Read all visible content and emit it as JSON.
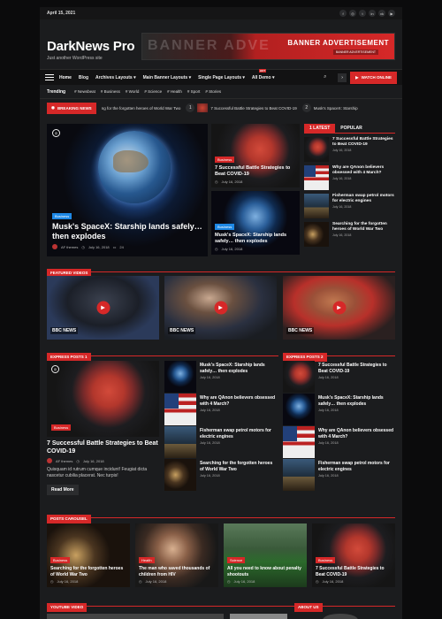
{
  "topbar": {
    "date": "April 15, 2021",
    "social": [
      "f",
      "◎",
      "t",
      "in",
      "vk",
      "▶"
    ]
  },
  "header": {
    "site_title": "DarkNews Pro",
    "tagline": "Just another WordPress site",
    "banner_ghost": "BANNER ADVE",
    "banner_title": "BANNER ADVERTISEMENT",
    "banner_sub": "BANNER ADVERTISEMENT"
  },
  "nav": {
    "items": [
      "Home",
      "Blog",
      "Archives Layouts ▾",
      "Main Banner Layouts ▾",
      "Single Page Layouts ▾",
      "All Demo ▾"
    ],
    "hot_badge": "HOT",
    "watch_label": "WATCH ONLINE"
  },
  "tags": {
    "label": "Trending",
    "items": [
      "# Newsbeat",
      "# Business",
      "# World",
      "# Science",
      "# Health",
      "# Sport",
      "# Stories"
    ]
  },
  "ticker": {
    "breaking_label": "BREAKING NEWS",
    "item1": "ng for the forgotten heroes of World War Two",
    "item2_num": "1",
    "item2": "7 Successful Battle Strategies to Beat COVID-19",
    "item3_num": "2",
    "item3": "Musk's SpaceX: Starship"
  },
  "hero": {
    "category": "Business",
    "title": "Musk's SpaceX: Starship lands safely… then explodes",
    "author": "AF themes",
    "date": "July 16, 2018",
    "comments": "24"
  },
  "mid_cards": [
    {
      "category": "Business",
      "title": "7 Successful Battle Strategies to Beat COVID-19",
      "date": "July 16, 2018"
    },
    {
      "category": "Business",
      "title": "Musk's SpaceX: Starship lands safely… then explodes",
      "date": "July 16, 2018"
    }
  ],
  "sidebar": {
    "tab_latest": "LATEST",
    "tab_popular": "POPULAR",
    "tab_num": "1",
    "items": [
      {
        "title": "7 Successful Battle Strategies to Beat COVID-19",
        "date": "July 16, 2018"
      },
      {
        "title": "Why are QAnon believers obsessed with 4 March?",
        "date": "July 16, 2018"
      },
      {
        "title": "Fisherman swap petrol motors for electric engines",
        "date": "July 16, 2018"
      },
      {
        "title": "Searching for the forgotten heroes of World War Two",
        "date": "July 16, 2018"
      }
    ]
  },
  "sections": {
    "featured_videos": "FEATURED VIDEOS",
    "express_posts_1": "EXPRESS POSTS 1",
    "express_posts_2": "EXPRESS POSTS 2",
    "posts_carousel": "POSTS CAROUSEL",
    "youtube_video": "YOUTUBE VIDEO",
    "about_us": "ABOUT US"
  },
  "videos": {
    "network": "BBC NEWS"
  },
  "express1": {
    "main": {
      "category": "Business",
      "title": "7 Successful Battle Strategies to Beat COVID-19",
      "author": "AF themes",
      "date": "July 16, 2018",
      "excerpt": "Quisquam id rutrum cumque incidunt! Feugiat dicta nascetur cubilia placerat. Nec turpis!",
      "readmore": "Read More"
    },
    "list": [
      {
        "title": "Musk's SpaceX: Starship lands safely… then explodes",
        "date": "July 16, 2018"
      },
      {
        "title": "Why are QAnon believers obsessed with 4 March?",
        "date": "July 16, 2018"
      },
      {
        "title": "Fisherman swap petrol motors for electric engines",
        "date": "July 16, 2018"
      },
      {
        "title": "Searching for the forgotten heroes of World War Two",
        "date": "July 16, 2018"
      }
    ]
  },
  "express2": {
    "list": [
      {
        "title": "7 Successful Battle Strategies to Beat COVID-19",
        "date": "July 16, 2018"
      },
      {
        "title": "Musk's SpaceX: Starship lands safely… then explodes",
        "date": "July 16, 2018"
      },
      {
        "title": "Why are QAnon believers obsessed with 4 March?",
        "date": "July 16, 2018"
      },
      {
        "title": "Fisherman swap petrol motors for electric engines",
        "date": "July 16, 2018"
      }
    ]
  },
  "carousel": [
    {
      "category": "Business",
      "title": "Searching for the forgotten heroes of World War Two",
      "date": "July 16, 2018"
    },
    {
      "category": "Health",
      "title": "The man who saved thousands of children from HIV",
      "date": "July 16, 2018"
    },
    {
      "category": "Science",
      "title": "All you need to know about penalty shootouts",
      "date": "July 16, 2018"
    },
    {
      "category": "Business",
      "title": "7 Successful Battle Strategies to Beat COVID-19",
      "date": "July 16, 2018"
    }
  ]
}
